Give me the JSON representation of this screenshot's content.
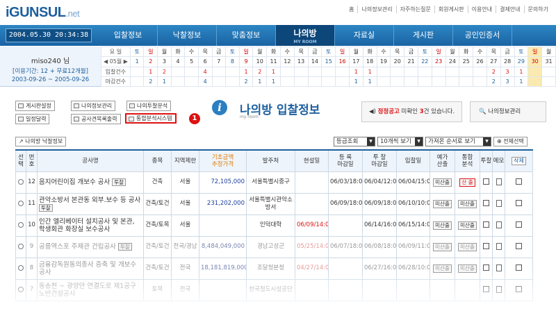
{
  "logo": {
    "main": "iGUNSUL",
    "suffix": ".net"
  },
  "top_links": [
    "홈",
    "나의정보관리",
    "자주하는질문",
    "회원게시판",
    "이용안내",
    "결제안내",
    "문의하기"
  ],
  "clock": "2004.05.30 20:34:38",
  "nav": [
    {
      "label": "입찰정보",
      "sub": ""
    },
    {
      "label": "낙찰정보",
      "sub": ""
    },
    {
      "label": "맞춤정보",
      "sub": ""
    },
    {
      "label": "나의방",
      "sub": "MY ROOM"
    },
    {
      "label": "자료실",
      "sub": ""
    },
    {
      "label": "게시판",
      "sub": ""
    },
    {
      "label": "공인인증서",
      "sub": ""
    }
  ],
  "user": {
    "name": "miso240 님",
    "period": "[이용기간: 12 + 무료12개월]",
    "dates": "2003-09-26 ~ 2005-09-26"
  },
  "calendar": {
    "weekday_label": "요 일",
    "month_label": "◀ 05월 ▶",
    "bid_label": "입찰건수",
    "close_label": "마감건수",
    "weekdays": [
      "토",
      "일",
      "월",
      "화",
      "수",
      "목",
      "금",
      "토",
      "일",
      "월",
      "화",
      "수",
      "목",
      "금",
      "토",
      "일",
      "월",
      "화",
      "수",
      "목",
      "금",
      "토",
      "일",
      "월",
      "화",
      "수",
      "목",
      "금",
      "토",
      "일",
      "월"
    ],
    "days": [
      "1",
      "2",
      "3",
      "4",
      "5",
      "6",
      "7",
      "8",
      "9",
      "10",
      "11",
      "12",
      "13",
      "14",
      "15",
      "16",
      "17",
      "18",
      "19",
      "20",
      "21",
      "22",
      "23",
      "24",
      "25",
      "26",
      "27",
      "28",
      "29",
      "30",
      "31"
    ],
    "bids": [
      "",
      "1",
      "2",
      "",
      "",
      "4",
      "",
      "",
      "1",
      "2",
      "1",
      "",
      "",
      "",
      "",
      "",
      "1",
      "1",
      "",
      "",
      "",
      "",
      "",
      "",
      "",
      "",
      "2",
      "3",
      "1",
      "",
      ""
    ],
    "closes": [
      "",
      "2",
      "1",
      "",
      "",
      "4",
      "",
      "",
      "2",
      "1",
      "1",
      "",
      "",
      "",
      "",
      "",
      "1",
      "1",
      "",
      "",
      "",
      "",
      "",
      "",
      "",
      "",
      "2",
      "3",
      "1",
      "",
      ""
    ]
  },
  "tools": {
    "board": "게시판설정",
    "myinfo": "나의정보관리",
    "analysis": "나의투찰분석",
    "schedule": "일정달력",
    "printout": "공사견목록출력",
    "system": "통합분석시스템"
  },
  "badge": "1",
  "title": {
    "main": "나의방 입찰정보",
    "sub": "my room"
  },
  "notice": {
    "prefix": "정정공고",
    "mid": "미확인",
    "count": "3",
    "suffix": "건 있습니다."
  },
  "mgr_button": "나의정보관리",
  "mytab_button": "나의방 낙찰정보",
  "selects": {
    "grade": "등급조회",
    "per_page": "10개씩 보기",
    "order": "가져온 순서로 보기"
  },
  "select_all": "전체선택",
  "headers": {
    "sel": "선택",
    "no": "번호",
    "name": "공사명",
    "type": "종목",
    "region": "지역제한",
    "amount1": "기초금액",
    "amount2": "추정가격",
    "client": "발주처",
    "site": "현설일",
    "reg1": "등 록",
    "reg2": "마감일",
    "bid1": "투 찰",
    "bid2": "마감일",
    "open": "입찰일",
    "price1": "예가",
    "price2": "산출",
    "anal1": "통합",
    "anal2": "분석",
    "tuchal": "투찰",
    "memo": "메모",
    "del": "삭제"
  },
  "rows": [
    {
      "no": "12",
      "name": "음지어린이집 개보수 공사",
      "tag": "투찰",
      "type": "건축",
      "region": "서울",
      "amount": "72,105,000",
      "client": "서울특별시중구",
      "site": "",
      "reg": "06/03/18:00",
      "bid": "06/04/12:00",
      "open": "06/04/15:00",
      "price": "미산출",
      "anal": "산 출",
      "anal_red": true
    },
    {
      "no": "11",
      "name": "관악소방서 본관동 외부.보수 등 공사",
      "tag": "투찰",
      "type": "건축/토건",
      "region": "서울",
      "amount": "231,202,000",
      "client": "서울특별시관악소방서",
      "site": "",
      "reg": "06/09/18:00",
      "bid": "06/09/18:00",
      "open": "06/10/10:00",
      "price": "미산출",
      "anal": "미산출",
      "anal_red": false
    },
    {
      "no": "10",
      "name": "인간 엘리베이터 설치공사 및 본관, 학생회관 화장실 보수공사",
      "tag": "",
      "type": "건축/토목",
      "region": "서울",
      "amount": "",
      "client": "인덕대학",
      "site": "06/09/14:00",
      "reg": "",
      "bid": "06/14/16:00",
      "open": "06/15/14:00",
      "price": "미산출",
      "anal": "미산출",
      "anal_red": false
    },
    {
      "no": "9",
      "name": "공릉역스포 주제관 건립공사",
      "tag": "투찰",
      "type": "건축/토건",
      "region": "전국/경남",
      "amount": "8,484,049,000",
      "client": "경남고성군",
      "site": "05/25/14:00",
      "reg": "06/07/18:00",
      "bid": "06/08/18:00",
      "open": "06/09/11:00",
      "price": "미산출",
      "anal": "미산출",
      "anal_red": false
    },
    {
      "no": "8",
      "name": "금융감독원동의종사 증축 및 개보수공사",
      "tag": "",
      "type": "건축/토건",
      "region": "전국",
      "amount": "18,181,819,000",
      "client": "조달청본청",
      "site": "04/27/14:00",
      "reg": "",
      "bid": "06/27/16:00",
      "open": "06/28/10:00",
      "price": "미산출",
      "anal": "미산출",
      "anal_red": false
    },
    {
      "no": "7",
      "name": "동송천 ~ 광양만 연결도로 제1공구 노반건설공사",
      "tag": "",
      "type": "토목",
      "region": "전국",
      "amount": "",
      "client": "한국철도시설공단",
      "site": "",
      "reg": "",
      "bid": "",
      "open": "",
      "price": "",
      "anal": "",
      "anal_red": false
    }
  ],
  "row_fade": [
    false,
    false,
    false,
    true,
    true,
    true
  ],
  "del_label": "삭제"
}
